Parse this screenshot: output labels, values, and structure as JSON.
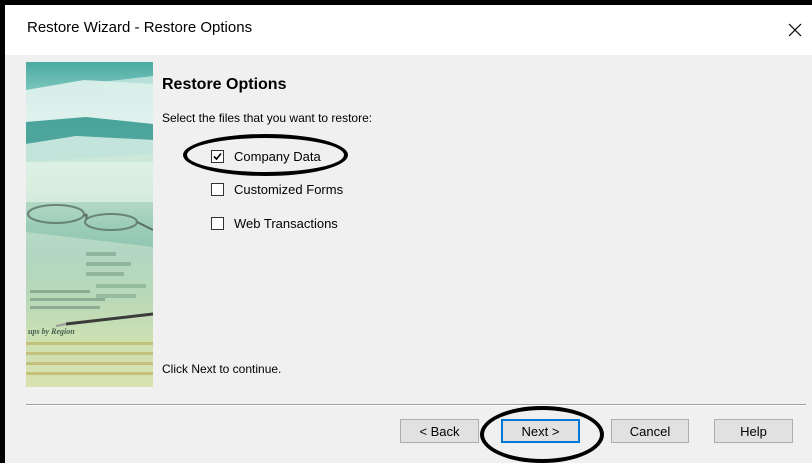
{
  "window": {
    "title": "Restore Wizard - Restore Options"
  },
  "close_icon": "close-icon",
  "banner": {
    "image": "financial-report-glasses-pen-illustration",
    "caption": "ups by Region",
    "colors": [
      "#4aa9a0",
      "#9ccdb9",
      "#e6dc86"
    ]
  },
  "content": {
    "heading": "Restore Options",
    "instruction": "Select the files that you want to restore:",
    "options": [
      {
        "label": "Company Data",
        "checked": true
      },
      {
        "label": "Customized Forms",
        "checked": false
      },
      {
        "label": "Web Transactions",
        "checked": false
      }
    ],
    "footer": "Click Next to continue."
  },
  "buttons": {
    "back": "< Back",
    "next": "Next >",
    "cancel": "Cancel",
    "help": "Help"
  },
  "accent_color": "#0078d7"
}
